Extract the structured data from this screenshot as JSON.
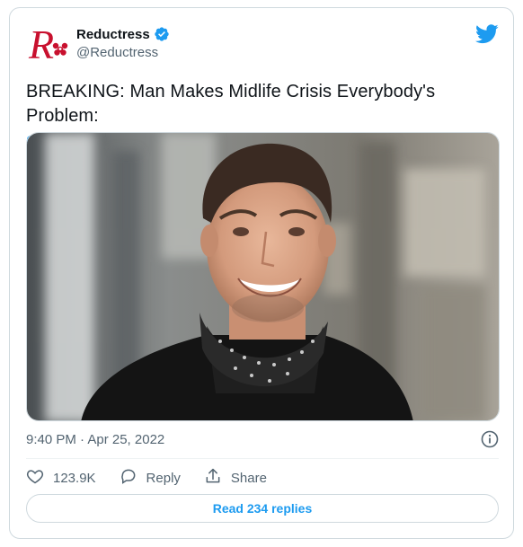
{
  "author": {
    "display_name": "Reductress",
    "handle": "@Reductress",
    "verified": true,
    "avatar_icon": "reductress-r-logo",
    "brand_color": "#c8102e"
  },
  "platform_icon": "twitter-bird-icon",
  "tweet": {
    "text": "BREAKING: Man Makes Midlife Crisis Everybody's Problem:",
    "link": "ow.ly/PAi450IRKV0",
    "timestamp": "9:40 PM · Apr 25, 2022"
  },
  "media": {
    "kind": "photo",
    "subject": "smiling man in black jacket with bandana neckerchief"
  },
  "actions": {
    "like_count": "123.9K",
    "reply_label": "Reply",
    "share_label": "Share"
  },
  "read_replies_label": "Read 234 replies",
  "colors": {
    "accent": "#1d9bf0",
    "like": "#536471",
    "border": "#cfd9de"
  }
}
